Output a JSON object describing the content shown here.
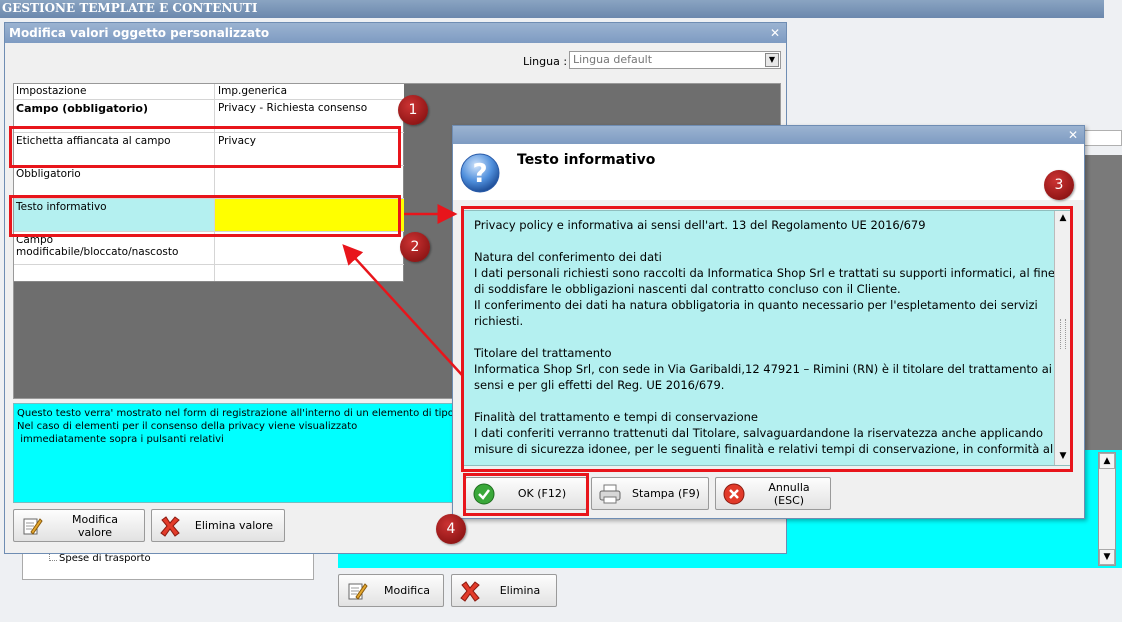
{
  "app": {
    "title": "GESTIONE TEMPLATE E CONTENUTI"
  },
  "background": {
    "tree_item": "Spese di trasporto",
    "modify_button": "Modifica",
    "delete_button": "Elimina"
  },
  "dialog_edit": {
    "title": "Modifica valori oggetto personalizzato",
    "language_label": "Lingua :",
    "language_value": "Lingua default",
    "grid": {
      "headers": [
        "Impostazione",
        "Imp.generica"
      ],
      "rows": [
        {
          "setting": "Campo (obbligatorio)",
          "value": "Privacy - Richiesta consenso"
        },
        {
          "setting": "Etichetta affiancata al campo",
          "value": "Privacy"
        },
        {
          "setting": "Obbligatorio",
          "value": ""
        },
        {
          "setting": "Testo informativo",
          "value": ""
        },
        {
          "setting": "Campo modificabile/bloccato/nascosto",
          "value": ""
        }
      ]
    },
    "info_text": "Questo testo verra' mostrato nel form di registrazione all'interno di un elemento di tipo \"text\nNel caso di elementi per il consenso della privacy viene visualizzato\n immediatamente sopra i pulsanti relativi",
    "modify_value_button": "Modifica valore",
    "delete_value_button": "Elimina valore"
  },
  "dialog_info": {
    "title": "",
    "heading": "Testo informativo",
    "body": "Privacy policy e informativa ai sensi dell'art. 13 del Regolamento UE 2016/679\n\nNatura del conferimento dei dati\nI dati personali richiesti sono raccolti da Informatica Shop Srl e trattati su supporti informatici, al fine di soddisfare le obbligazioni nascenti dal contratto concluso con il Cliente.\nIl conferimento dei dati ha natura obbligatoria in quanto necessario per l'espletamento dei servizi richiesti.\n\nTitolare del trattamento\nInformatica Shop Srl, con sede in Via Garibaldi,12 47921 – Rimini (RN) è il titolare del trattamento ai sensi e per gli effetti del Reg. UE 2016/679.\n\nFinalità del trattamento e tempi di conservazione\nI dati conferiti verranno trattenuti dal Titolare, salvaguardandone la riservatezza anche applicando misure di sicurezza idonee, per le seguenti finalità e relativi tempi di conservazione, in conformità al",
    "ok_button": "OK (F12)",
    "print_button": "Stampa (F9)",
    "cancel_button": "Annulla (ESC)"
  },
  "callouts": [
    "1",
    "2",
    "3",
    "4"
  ],
  "colors": {
    "highlight": "#e8151b",
    "cyan_field": "#00ffff",
    "yellow_cell": "#ffff00",
    "selected_row": "#b4f0f0"
  }
}
